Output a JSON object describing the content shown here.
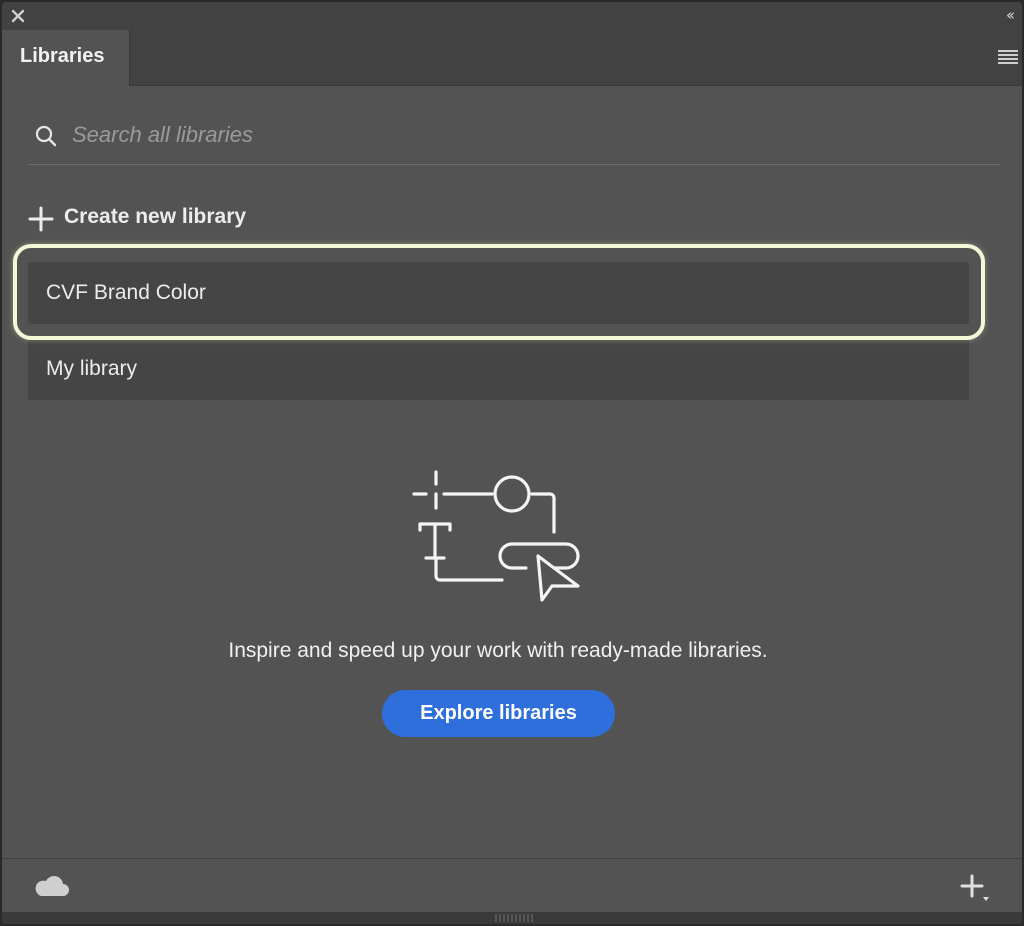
{
  "window": {
    "close_icon": "close-icon",
    "collapse_label": "‹‹"
  },
  "tabs": [
    {
      "label": "Libraries",
      "active": true
    }
  ],
  "panel_menu_icon": "hamburger-menu-icon",
  "search": {
    "placeholder": "Search all libraries",
    "value": "",
    "icon": "search-icon"
  },
  "create_new": {
    "label": "Create new library",
    "icon": "plus-icon"
  },
  "libraries": [
    {
      "name": "CVF Brand Color",
      "highlighted": true
    },
    {
      "name": "My library",
      "highlighted": false
    }
  ],
  "promo": {
    "illustration": "library-assets-illustration",
    "text": "Inspire and speed up your work with ready-made libraries.",
    "button_label": "Explore libraries"
  },
  "footer": {
    "left_icon": "cloud-icon",
    "right_icon": "add-dropdown-icon"
  },
  "colors": {
    "panel_bg": "#535353",
    "chrome_bg": "#424242",
    "item_bg": "#454545",
    "accent_blue": "#2f6fdb",
    "highlight": "#f5f8d6"
  }
}
